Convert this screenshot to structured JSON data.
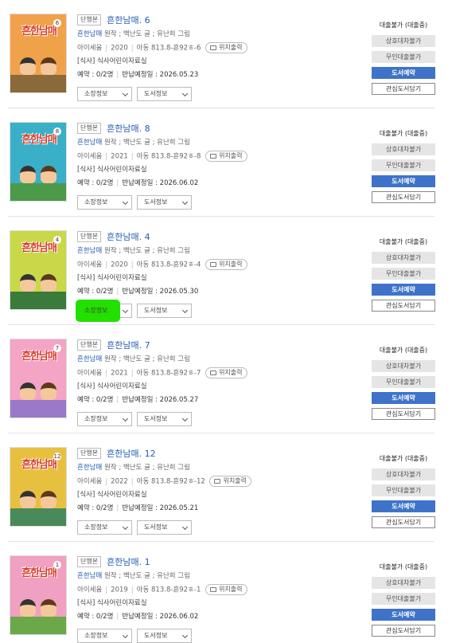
{
  "items": [
    {
      "badge": "단행본",
      "title": "흔한남매. 6",
      "author_link": "흔한남매",
      "author_rest": "원작 ; 백난도 글 ; 유난희 그림",
      "publisher": "아이세움",
      "year": "2020",
      "call_no": "아동 813.8-흔92ㅎ-6",
      "print_label": "위치출력",
      "location": "[식사] 식사어린이자료실",
      "reservation": "예약 : 0/2명",
      "due": "반납예정일 : 2026.05.23",
      "select_holdings": "소장정보",
      "select_info": "도서정보",
      "btn_loan": "대출불가 (대출중)",
      "btn_ill": "상호대차불가",
      "btn_kiosk": "무인대출불가",
      "btn_reserve": "도서예약",
      "btn_wish": "관심도서담기",
      "cover_bg": "#f0a24a",
      "cover_ground": "#8a6a3a",
      "cover_num": "6"
    },
    {
      "badge": "단행본",
      "title": "흔한남매. 8",
      "author_link": "흔한남매",
      "author_rest": "원작 ; 백난도 글 ; 유난희 그림",
      "publisher": "아이세움",
      "year": "2021",
      "call_no": "아동 813.8-흔92ㅎ-8",
      "print_label": "위치출력",
      "location": "[식사] 식사어린이자료실",
      "reservation": "예약 : 0/2명",
      "due": "반납예정일 : 2026.06.02",
      "select_holdings": "소장정보",
      "select_info": "도서정보",
      "btn_loan": "대출불가 (대출중)",
      "btn_ill": "상호대차불가",
      "btn_kiosk": "무인대출불가",
      "btn_reserve": "도서예약",
      "btn_wish": "관심도서담기",
      "cover_bg": "#3ab0c8",
      "cover_ground": "#4a9a4a",
      "cover_num": "8"
    },
    {
      "badge": "단행본",
      "title": "흔한남매. 4",
      "author_link": "흔한남매",
      "author_rest": "원작 ; 백난도 글 ; 유난희 그림",
      "publisher": "아이세움",
      "year": "2020",
      "call_no": "아동 813.8-흔92ㅎ-4",
      "print_label": "위치출력",
      "location": "[식사] 식사어린이자료실",
      "reservation": "예약 : 0/2명",
      "due": "반납예정일 : 2026.05.30",
      "select_holdings": "소장정보",
      "select_info": "도서정보",
      "btn_loan": "대출불가 (대출중)",
      "btn_ill": "상호대차불가",
      "btn_kiosk": "무인대출불가",
      "btn_reserve": "도서예약",
      "btn_wish": "관심도서담기",
      "cover_bg": "#c8d848",
      "cover_ground": "#3a7a3a",
      "cover_num": "4"
    },
    {
      "badge": "단행본",
      "title": "흔한남매. 7",
      "author_link": "흔한남매",
      "author_rest": "원작 ; 백난도 글 ; 유난희 그림",
      "publisher": "아이세움",
      "year": "2021",
      "call_no": "아동 813.8-흔92ㅎ-7",
      "print_label": "위치출력",
      "location": "[식사] 식사어린이자료실",
      "reservation": "예약 : 0/2명",
      "due": "반납예정일 : 2026.05.27",
      "select_holdings": "소장정보",
      "select_info": "도서정보",
      "btn_loan": "대출불가 (대출중)",
      "btn_ill": "상호대차불가",
      "btn_kiosk": "무인대출불가",
      "btn_reserve": "도서예약",
      "btn_wish": "관심도서담기",
      "cover_bg": "#f4a4c4",
      "cover_ground": "#9a7ac8",
      "cover_num": "7"
    },
    {
      "badge": "단행본",
      "title": "흔한남매. 12",
      "author_link": "흔한남매",
      "author_rest": "원작 ; 백난도 글 ; 유난희 그림",
      "publisher": "아이세움",
      "year": "2022",
      "call_no": "아동 813.8-흔92ㅎ-12",
      "print_label": "위치출력",
      "location": "[식사] 식사어린이자료실",
      "reservation": "예약 : 0/2명",
      "due": "반납예정일 : 2026.05.21",
      "select_holdings": "소장정보",
      "select_info": "도서정보",
      "btn_loan": "대출불가 (대출중)",
      "btn_ill": "상호대차불가",
      "btn_kiosk": "무인대출불가",
      "btn_reserve": "도서예약",
      "btn_wish": "관심도서담기",
      "cover_bg": "#e8c040",
      "cover_ground": "#4a8a5a",
      "cover_num": "12"
    },
    {
      "badge": "단행본",
      "title": "흔한남매. 1",
      "author_link": "흔한남매",
      "author_rest": "원작 ; 백난도 글 ; 유난희 그림",
      "publisher": "아이세움",
      "year": "2019",
      "call_no": "아동 813.8-흔92ㅎ-1",
      "print_label": "위치출력",
      "location": "[식사] 식사어린이자료실",
      "reservation": "예약 : 0/2명",
      "due": "반납예정일 : 2026.06.02",
      "select_holdings": "소장정보",
      "select_info": "도서정보",
      "btn_loan": "대출불가 (대출중)",
      "btn_ill": "상호대차불가",
      "btn_kiosk": "무인대출불가",
      "btn_reserve": "도서예약",
      "btn_wish": "관심도서담기",
      "cover_bg": "#f0a0c0",
      "cover_ground": "#6aa84a",
      "cover_num": "1"
    }
  ],
  "highlight_color": "#22e000"
}
